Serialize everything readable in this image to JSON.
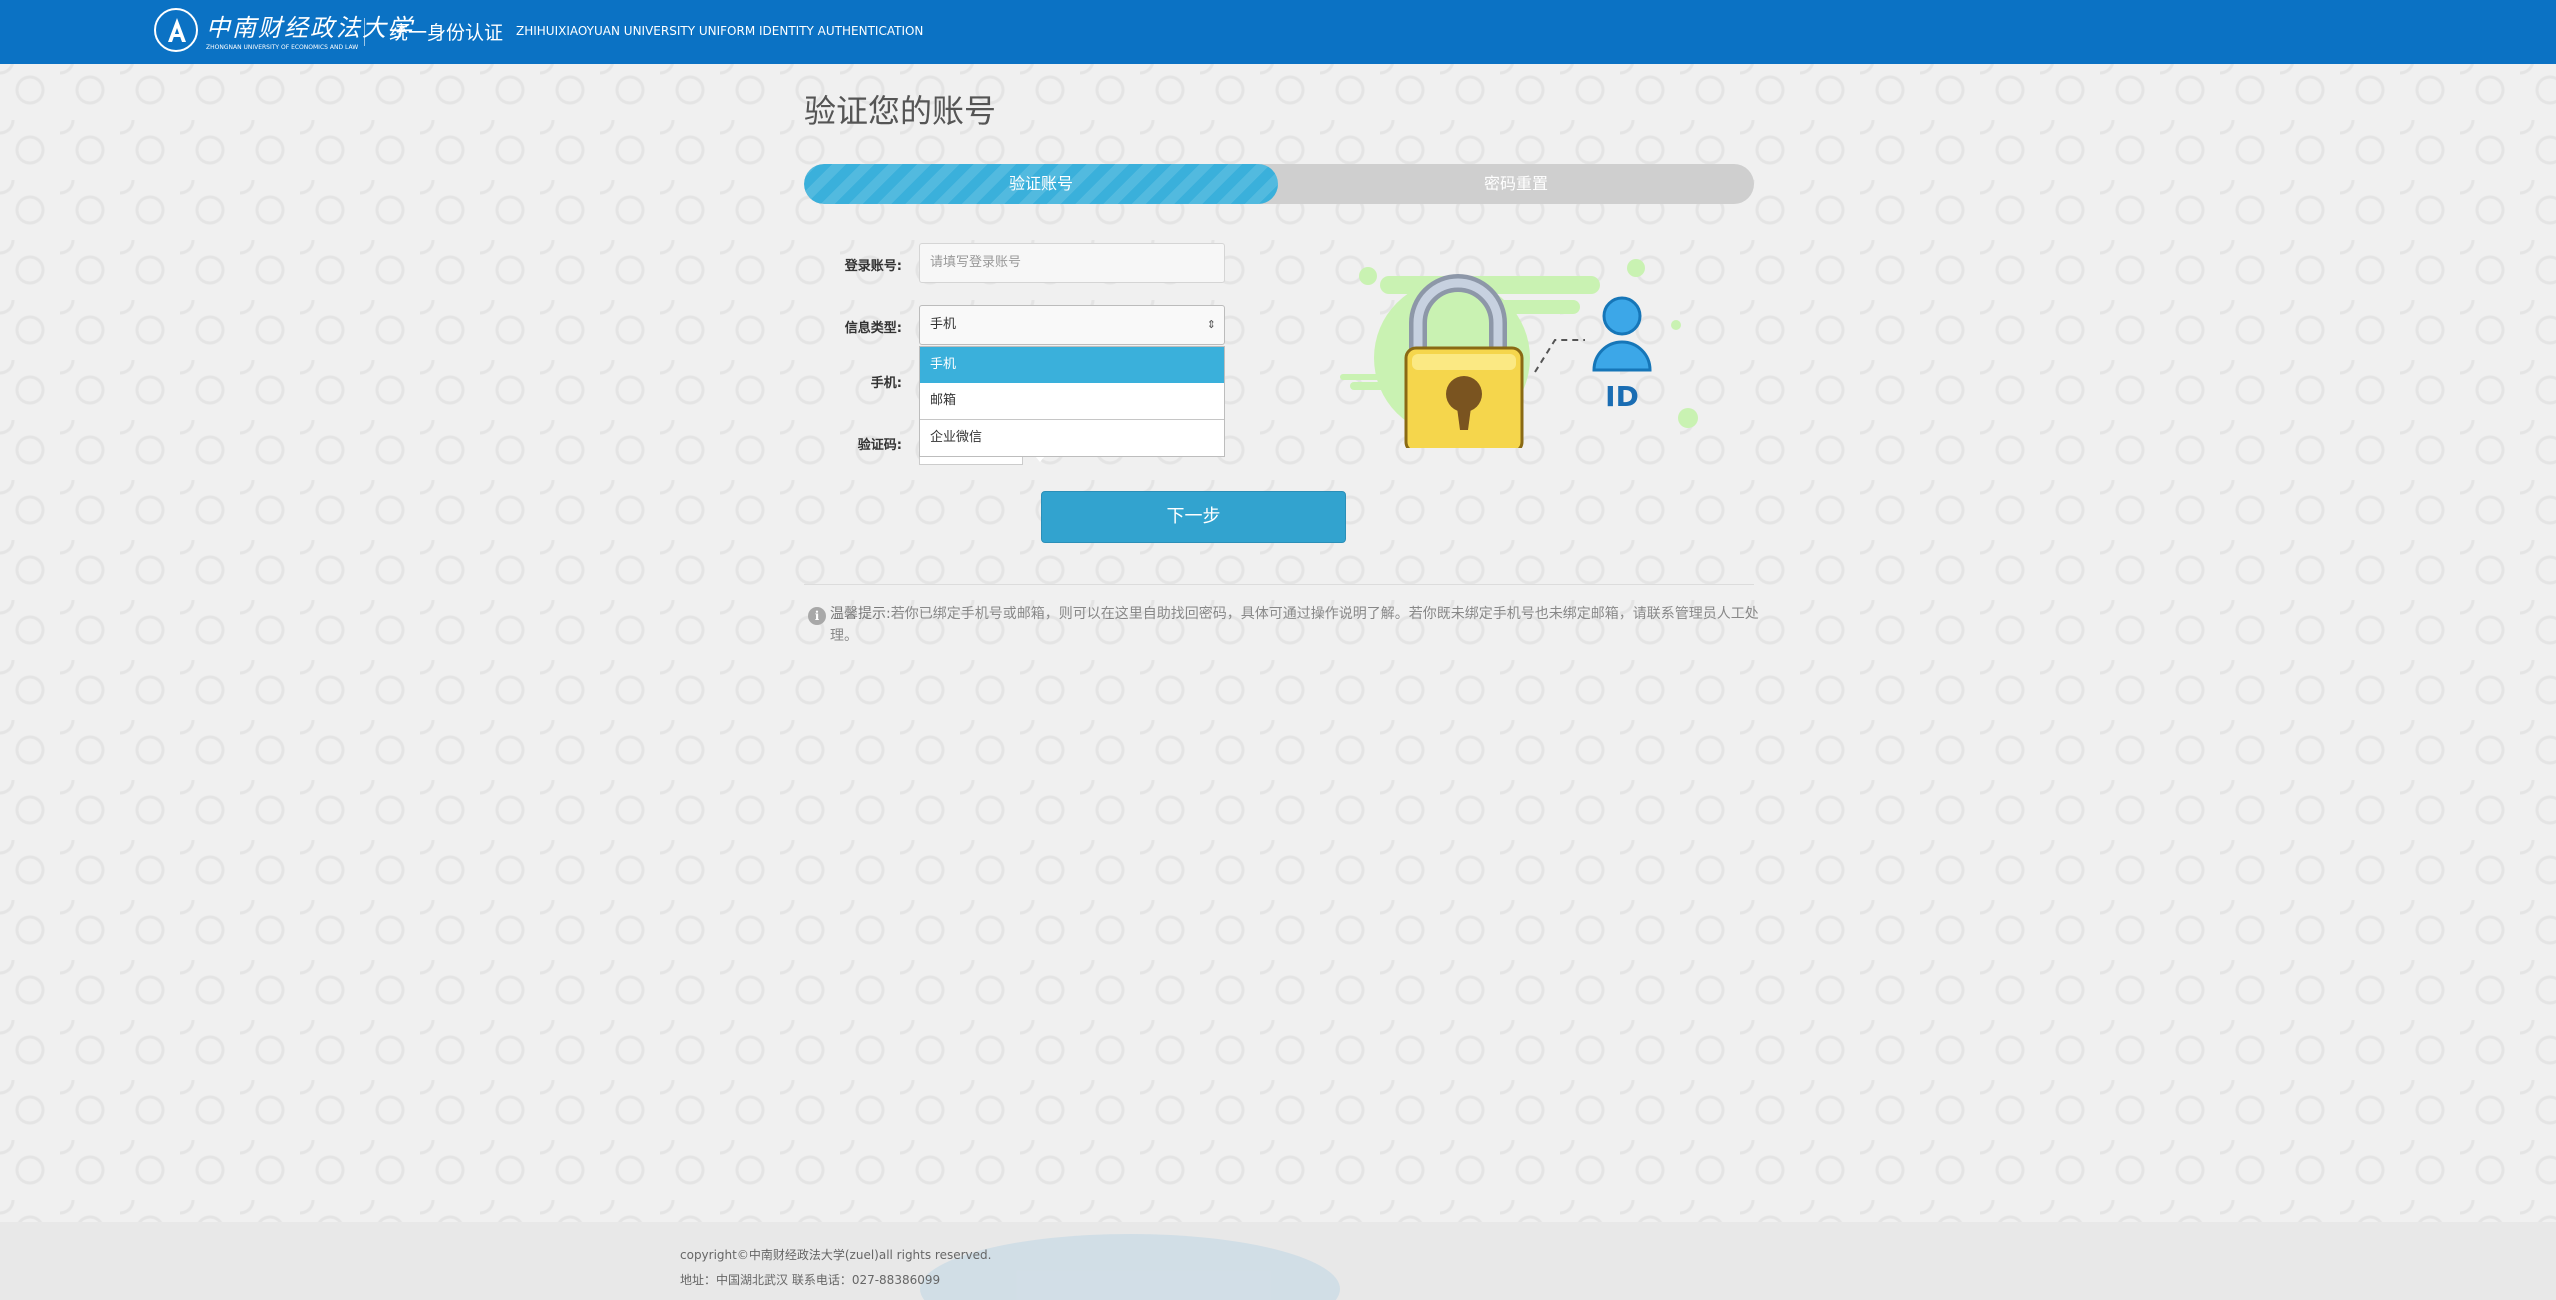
{
  "header": {
    "logo_cn": "中南财经政法大学",
    "logo_en": "ZHONGNAN UNIVERSITY OF ECONOMICS AND LAW",
    "title": "统一身份认证",
    "subtitle": "ZHIHUIXIAOYUAN UNIVERSITY UNIFORM IDENTITY AUTHENTICATION"
  },
  "page": {
    "title": "验证您的账号"
  },
  "steps": [
    {
      "label": "验证账号",
      "active": true
    },
    {
      "label": "密码重置",
      "active": false
    }
  ],
  "form": {
    "account_label": "登录账号:",
    "account_placeholder": "请填写登录账号",
    "info_type_label": "信息类型:",
    "info_type_selected": "手机",
    "phone_label": "手机:",
    "captcha_label": "验证码:",
    "dropdown_options": [
      "手机",
      "邮箱",
      "企业微信"
    ],
    "next_button": "下一步"
  },
  "illustration": {
    "id_text": "ID"
  },
  "tip": {
    "label": "温馨提示:",
    "text": "若你已绑定手机号或邮箱，则可以在这里自助找回密码，具体可通过操作说明了解。若你既未绑定手机号也未绑定邮箱，请联系管理员人工处理。"
  },
  "footer": {
    "copyright": "copyright©中南财经政法大学(zuel)all rights reserved.",
    "address": "地址：中国湖北武汉 联系电话：027-88386099"
  },
  "colors": {
    "header_bg": "#0b72c4",
    "accent": "#3ab0db",
    "button": "#32a3cf"
  }
}
